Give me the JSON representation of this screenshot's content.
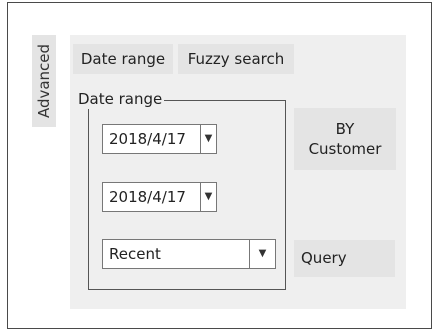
{
  "sidebar": {
    "advanced_tab": "Advanced"
  },
  "tabs": [
    {
      "label": "Date range"
    },
    {
      "label": "Fuzzy search"
    }
  ],
  "date_range_group": {
    "legend": "Date range",
    "from_date": {
      "value": "2018/4/17",
      "arrow": "▼"
    },
    "to_date": {
      "value": "2018/4/17",
      "arrow": "▼"
    },
    "period": {
      "value": "Recent",
      "arrow": "▼"
    }
  },
  "buttons": {
    "by_customer_line1": "BY",
    "by_customer_line2": "Customer",
    "query": "Query"
  }
}
